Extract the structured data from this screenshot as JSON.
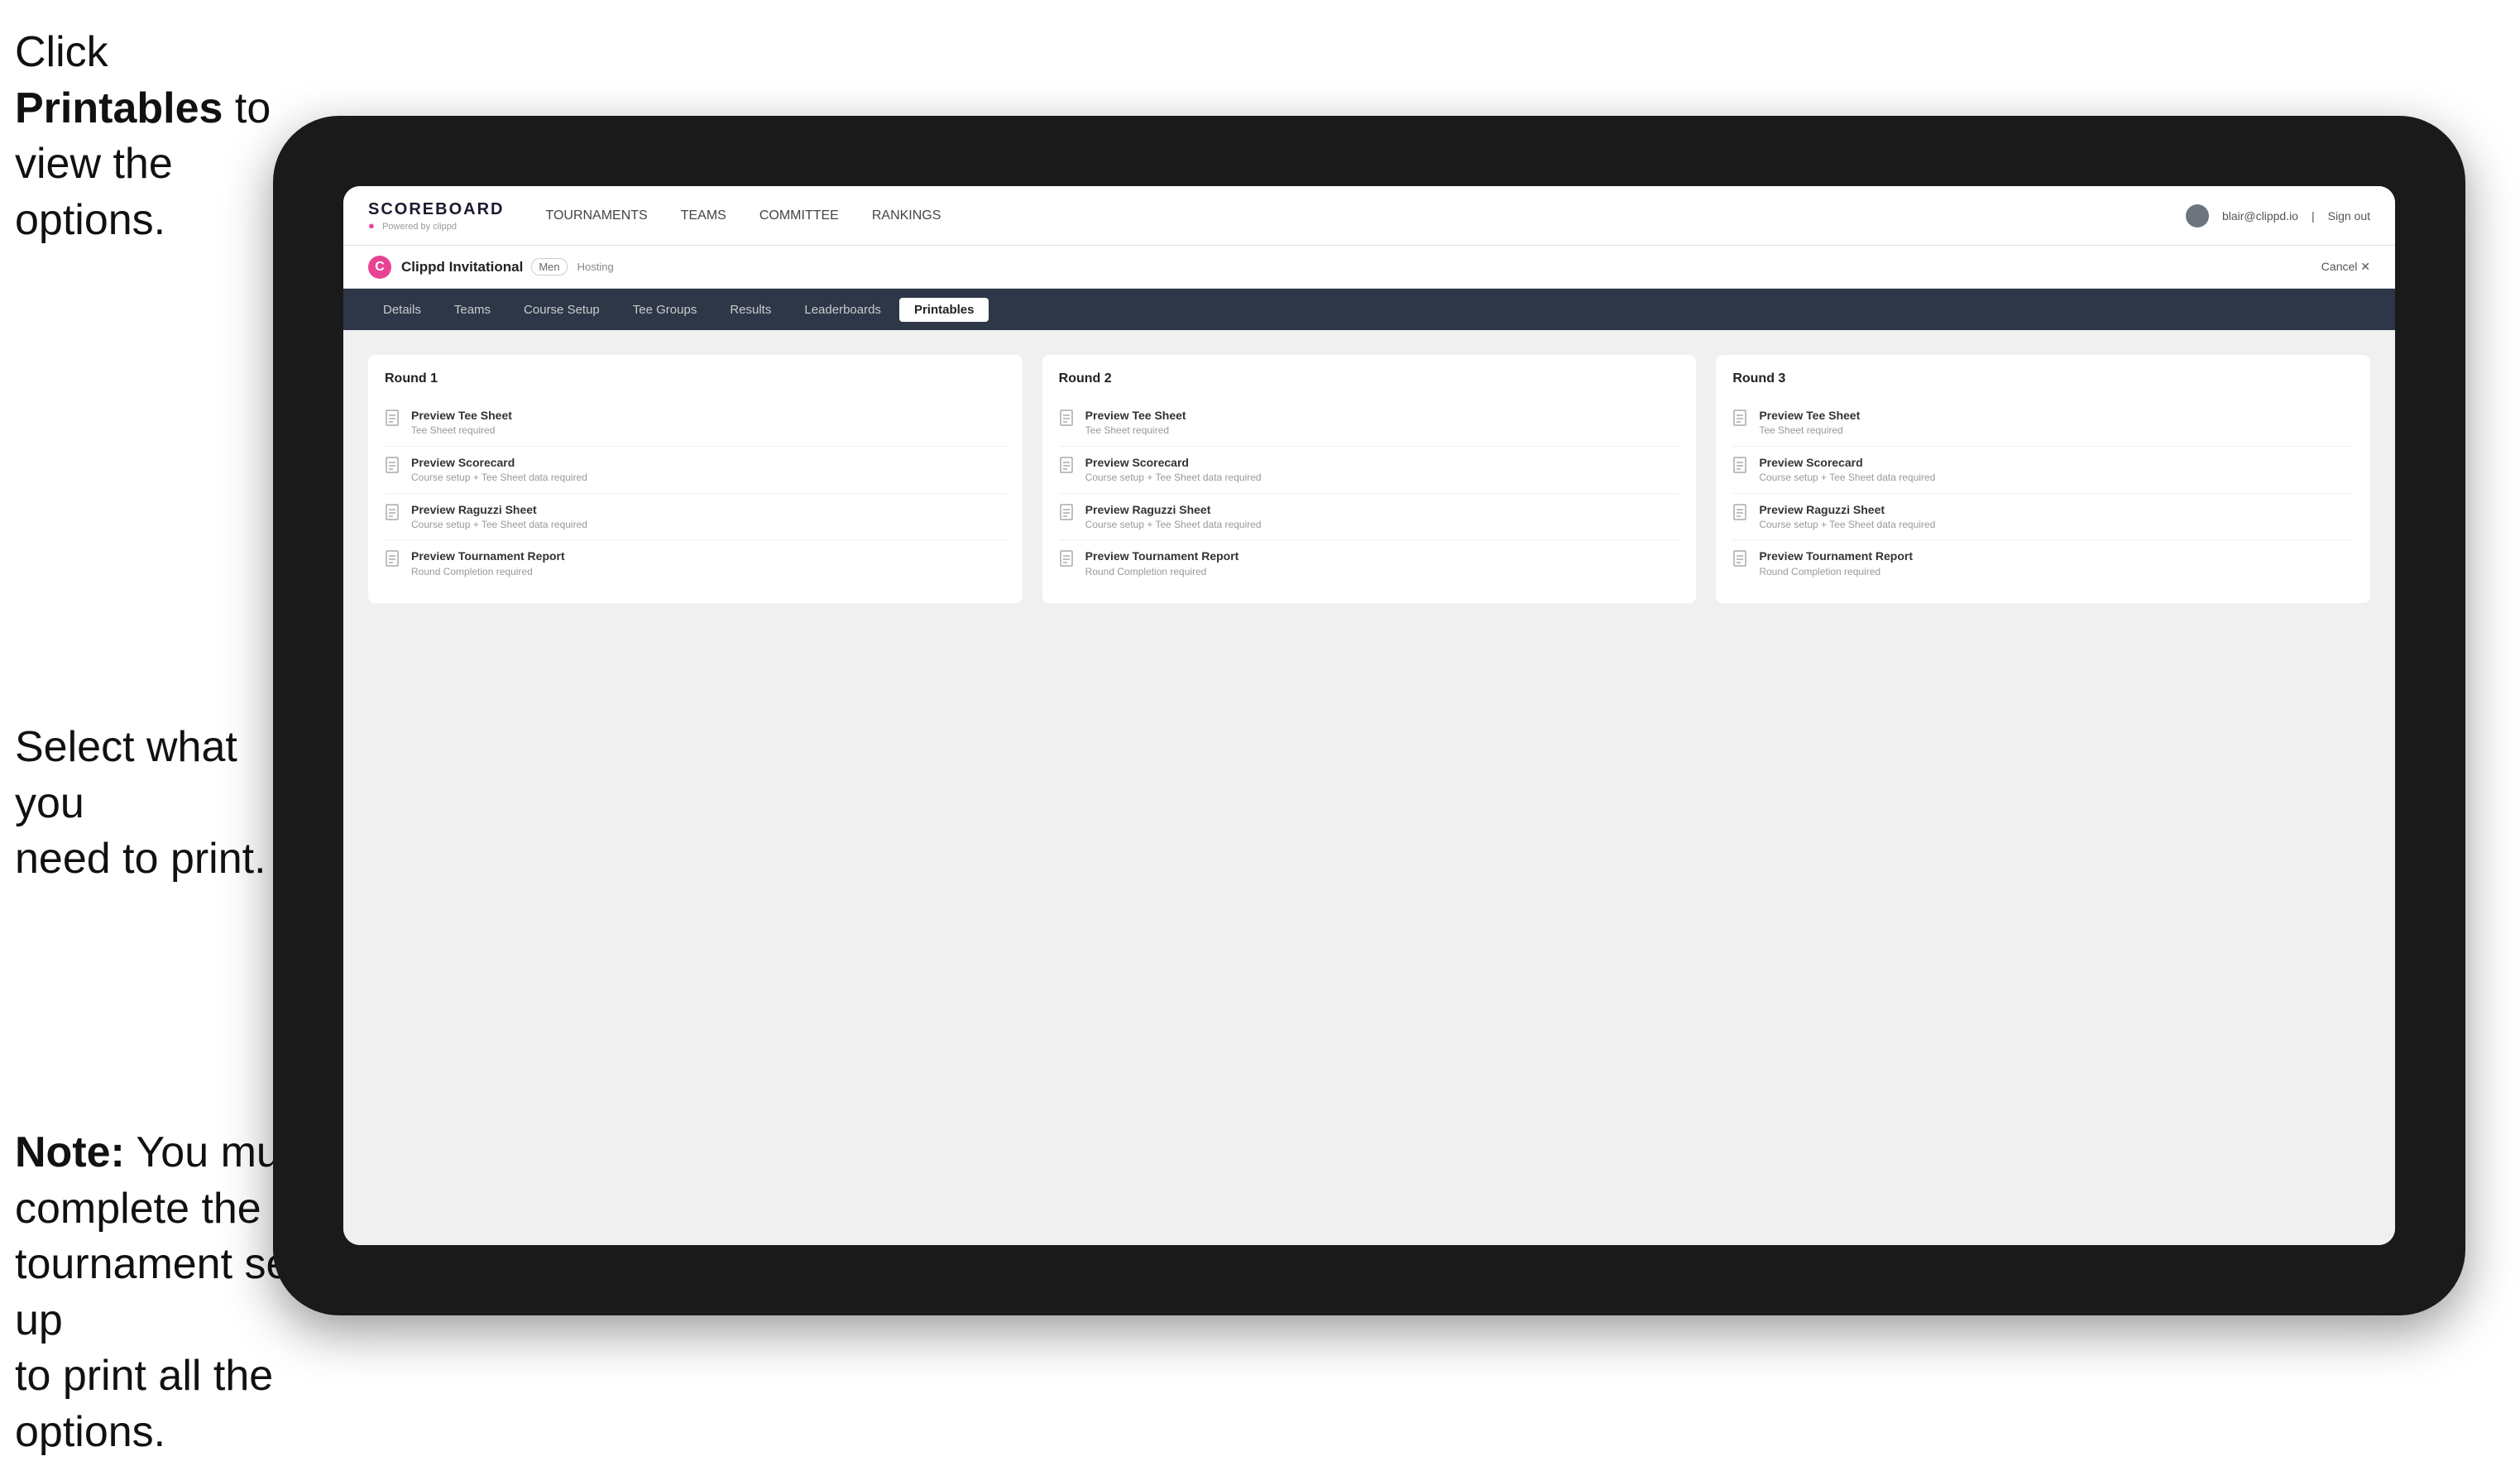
{
  "instructions": {
    "top": "Click ",
    "top_bold": "Printables",
    "top_rest": " to view the options.",
    "middle_line1": "Select what you",
    "middle_line2": "need to print.",
    "bottom_bold": "Note:",
    "bottom_rest": " You must complete the tournament set-up to print all the options."
  },
  "top_nav": {
    "logo_title": "SCOREBOARD",
    "logo_sub": "Powered by clippd",
    "links": [
      {
        "label": "TOURNAMENTS",
        "active": false
      },
      {
        "label": "TEAMS",
        "active": false
      },
      {
        "label": "COMMITTEE",
        "active": false
      },
      {
        "label": "RANKINGS",
        "active": false
      }
    ],
    "user_email": "blair@clippd.io",
    "sign_out": "Sign out",
    "separator": "|"
  },
  "tournament_bar": {
    "logo_letter": "C",
    "name": "Clippd Invitational",
    "badge": "Men",
    "hosting": "Hosting",
    "cancel": "Cancel ✕"
  },
  "sub_tabs": [
    {
      "label": "Details",
      "active": false
    },
    {
      "label": "Teams",
      "active": false
    },
    {
      "label": "Course Setup",
      "active": false
    },
    {
      "label": "Tee Groups",
      "active": false
    },
    {
      "label": "Results",
      "active": false
    },
    {
      "label": "Leaderboards",
      "active": false
    },
    {
      "label": "Printables",
      "active": true
    }
  ],
  "rounds": [
    {
      "title": "Round 1",
      "items": [
        {
          "title": "Preview Tee Sheet",
          "subtitle": "Tee Sheet required"
        },
        {
          "title": "Preview Scorecard",
          "subtitle": "Course setup + Tee Sheet data required"
        },
        {
          "title": "Preview Raguzzi Sheet",
          "subtitle": "Course setup + Tee Sheet data required"
        },
        {
          "title": "Preview Tournament Report",
          "subtitle": "Round Completion required"
        }
      ]
    },
    {
      "title": "Round 2",
      "items": [
        {
          "title": "Preview Tee Sheet",
          "subtitle": "Tee Sheet required"
        },
        {
          "title": "Preview Scorecard",
          "subtitle": "Course setup + Tee Sheet data required"
        },
        {
          "title": "Preview Raguzzi Sheet",
          "subtitle": "Course setup + Tee Sheet data required"
        },
        {
          "title": "Preview Tournament Report",
          "subtitle": "Round Completion required"
        }
      ]
    },
    {
      "title": "Round 3",
      "items": [
        {
          "title": "Preview Tee Sheet",
          "subtitle": "Tee Sheet required"
        },
        {
          "title": "Preview Scorecard",
          "subtitle": "Course setup + Tee Sheet data required"
        },
        {
          "title": "Preview Raguzzi Sheet",
          "subtitle": "Course setup + Tee Sheet data required"
        },
        {
          "title": "Preview Tournament Report",
          "subtitle": "Round Completion required"
        }
      ]
    }
  ]
}
